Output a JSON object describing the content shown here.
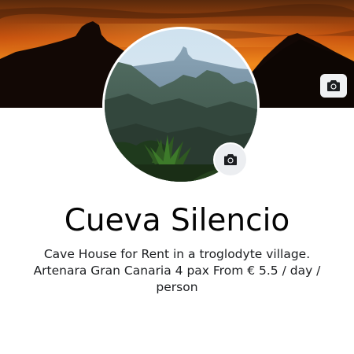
{
  "profile": {
    "name": "Cueva Silencio",
    "bio": "Cave House for Rent in a troglodyte village. Artenara Gran Canaria 4 pax From € 5.5 / day / person"
  },
  "icons": {
    "cover_camera": "camera-icon",
    "avatar_camera": "camera-icon"
  },
  "colors": {
    "background": "#ffffff",
    "title_text": "#050505",
    "bio_text": "#1c1e21",
    "camera_button_bg": "#f0f1f3"
  }
}
